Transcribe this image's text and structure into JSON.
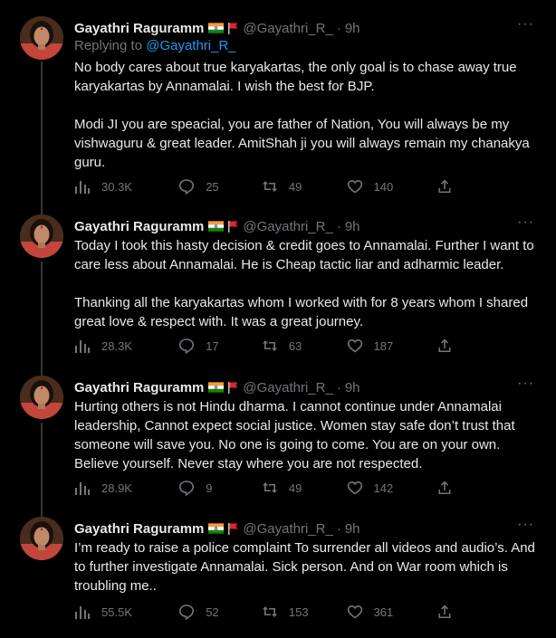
{
  "colors": {
    "background": "#000000",
    "text": "#e7e9ea",
    "muted": "#71767b",
    "link": "#1d9bf0",
    "thread": "#333639"
  },
  "tweets": [
    {
      "name": "Gayathri Raguramm",
      "handle": "@Gayathri_R_",
      "time": "9h",
      "more": "···",
      "replying_prefix": "Replying to ",
      "replying_to": "@Gayathri_R_",
      "text": "No body cares about true karyakartas, the only goal is to chase away true karyakartas by Annamalai. I wish the best for BJP.\n\nModi JI you are speacial, you are father of Nation, You will always be my vishwaguru & great leader. AmitShah ji you will always remain my chanakya guru.",
      "views": "30.3K",
      "replies": "25",
      "retweets": "49",
      "likes": "140"
    },
    {
      "name": "Gayathri Raguramm",
      "handle": "@Gayathri_R_",
      "time": "9h",
      "more": "···",
      "text": "Today I took this hasty decision & credit goes to Annamalai. Further I want to care less about Annamalai. He is Cheap tactic liar and adharmic leader.\n\nThanking all the karyakartas whom I worked with for 8 years whom I shared great love & respect with. It was a great journey.",
      "views": "28.3K",
      "replies": "17",
      "retweets": "63",
      "likes": "187"
    },
    {
      "name": "Gayathri Raguramm",
      "handle": "@Gayathri_R_",
      "time": "9h",
      "more": "···",
      "text": "Hurting others is not Hindu dharma. I cannot continue under Annamalai leadership, Cannot expect social justice. Women stay safe don’t trust that someone will save you. No one is going to come. You are on your own. Believe yourself. Never stay where you are not respected.",
      "views": "28.9K",
      "replies": "9",
      "retweets": "49",
      "likes": "142"
    },
    {
      "name": "Gayathri Raguramm",
      "handle": "@Gayathri_R_",
      "time": "9h",
      "more": "···",
      "text": "I’m ready to raise a police complaint To surrender all videos and audio’s. And to further investigate Annamalai. Sick person. And on War room which is troubling me..",
      "views": "55.5K",
      "replies": "52",
      "retweets": "153",
      "likes": "361"
    }
  ]
}
